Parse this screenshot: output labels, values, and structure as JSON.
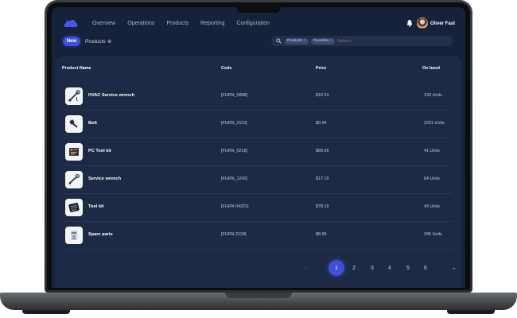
{
  "nav": {
    "items": [
      "Overview",
      "Operations",
      "Products",
      "Reporting",
      "Configuration"
    ]
  },
  "user": {
    "name": "Oliver Fast"
  },
  "toolbar": {
    "new_label": "New",
    "breadcrumb": "Products"
  },
  "search": {
    "filters": [
      "Products",
      "Favorites"
    ],
    "placeholder": "Search"
  },
  "table": {
    "columns": [
      "Product Name",
      "Code",
      "Price",
      "On hand"
    ],
    "rows": [
      {
        "name": "HVAC Service wrench",
        "code": "[FURN_0988]",
        "price": "$16.24",
        "on_hand": "233 Units",
        "icon": "wrench-icon"
      },
      {
        "name": "Bolt",
        "code": "[FURN_0113]",
        "price": "$0.94",
        "on_hand": "2231 Units",
        "icon": "bolt-icon"
      },
      {
        "name": "PC Tool kit",
        "code": "[FURN_0216]",
        "price": "$89.99",
        "on_hand": "41 Units",
        "icon": "pc-toolkit-icon"
      },
      {
        "name": "Service wrench",
        "code": "[FURN_1242]",
        "price": "$17.19",
        "on_hand": "64 Units",
        "icon": "service-wrench-icon"
      },
      {
        "name": "Tool kit",
        "code": "[FURN 04321]",
        "price": "$78.19",
        "on_hand": "43 Units",
        "icon": "toolkit-icon"
      },
      {
        "name": "Spare parts",
        "code": "[FURN 2124]",
        "price": "$8.99",
        "on_hand": "345 Units",
        "icon": "spare-parts-icon"
      }
    ]
  },
  "pagination": {
    "prev": "←",
    "next": "→",
    "pages": [
      "1",
      "2",
      "3",
      "4",
      "5",
      "6"
    ],
    "current": "1"
  },
  "colors": {
    "accent": "#3f4fd8",
    "screen_bg": "#16213a",
    "card_bg": "#1d2a45"
  }
}
